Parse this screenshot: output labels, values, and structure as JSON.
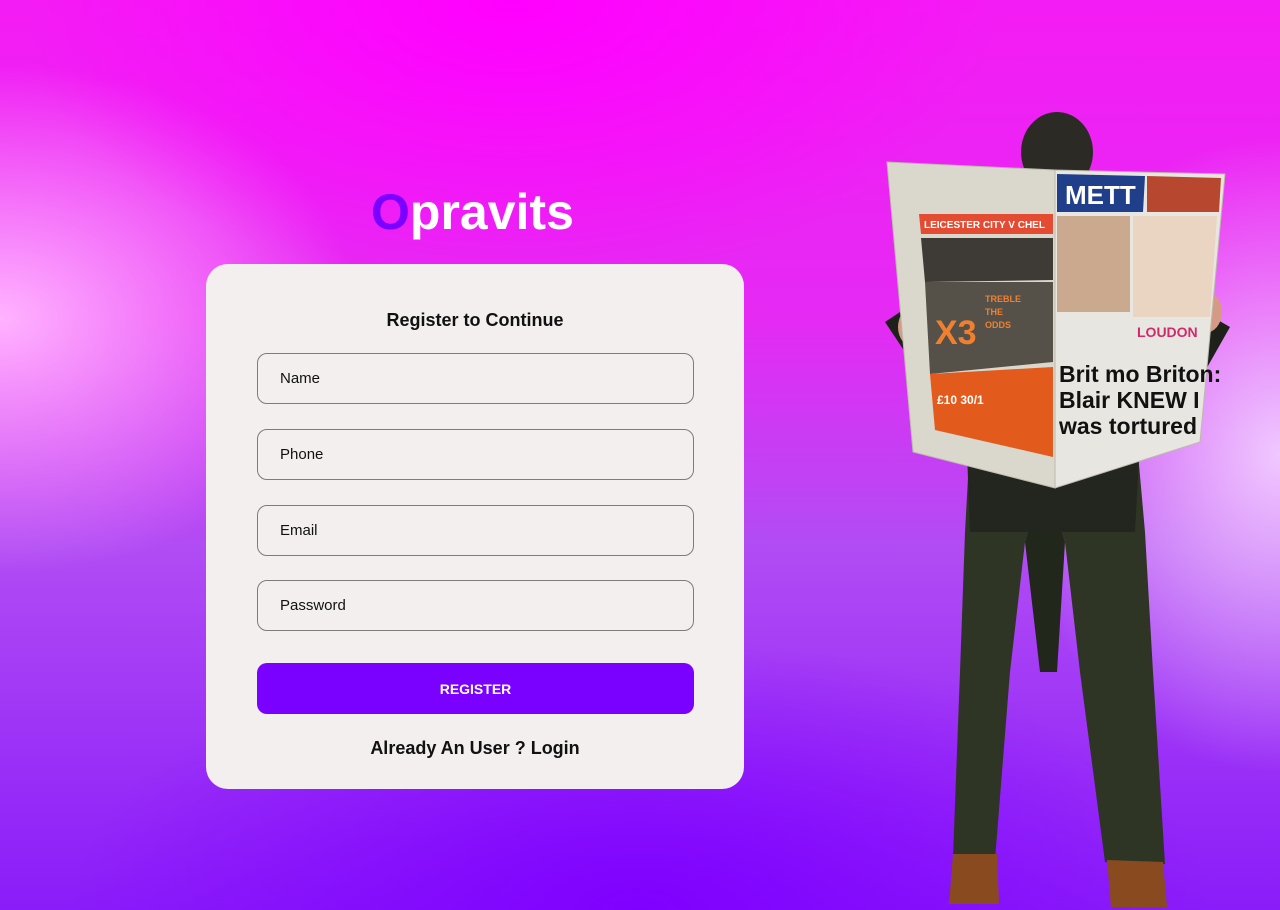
{
  "brand": {
    "first_letter": "O",
    "rest": "pravits"
  },
  "form": {
    "title": "Register to Continue",
    "fields": {
      "name": {
        "placeholder": "Name"
      },
      "phone": {
        "placeholder": "Phone"
      },
      "email": {
        "placeholder": "Email"
      },
      "password": {
        "placeholder": "Password"
      }
    },
    "register_label": "REGISTER",
    "login_prompt": "Already An User ? Login"
  },
  "illustration": {
    "newspaper": {
      "left_header": "LEICESTER CITY V CHEL",
      "promo_big": "X3",
      "promo_lines": [
        "TREBLE",
        "THE",
        "ODDS"
      ],
      "offer": "£10 30/1",
      "masthead": "METT",
      "headline_lines": [
        "Brit mo Briton:",
        "Blair KNEW I",
        "was tortured"
      ],
      "celebrity_name": "LOUDON"
    }
  },
  "colors": {
    "accent": "#7a00ff",
    "card_bg": "#f3efee",
    "brand_text": "#ffffff"
  }
}
